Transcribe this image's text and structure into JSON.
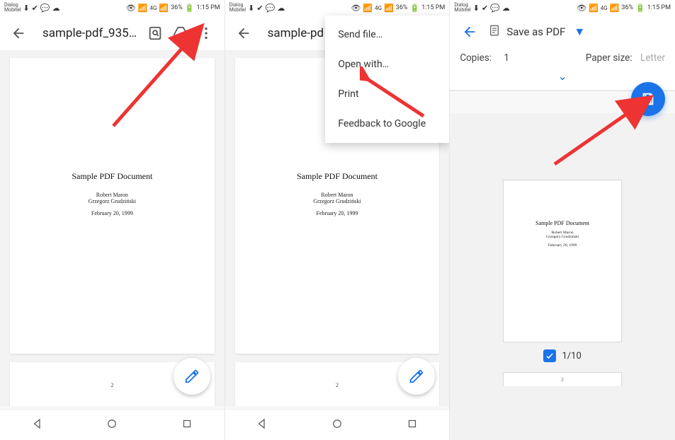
{
  "status": {
    "carrier": "Dialog\nMobitel",
    "battery": "36%",
    "time": "1:15 PM",
    "net": "4G"
  },
  "panel1": {
    "title": "sample-pdf_935…"
  },
  "doc": {
    "title": "Sample PDF Document",
    "author1": "Robert Maron",
    "author2": "Grzegorz Grudziński",
    "date": "February 20, 1999",
    "page2num": "2"
  },
  "panel2": {
    "title": "sample-pd",
    "menu": {
      "send": "Send file…",
      "open": "Open with…",
      "print": "Print",
      "feedback": "Feedback to Google"
    }
  },
  "panel3": {
    "saveas": "Save as PDF",
    "copies_label": "Copies:",
    "copies_value": "1",
    "paper_label": "Paper size:",
    "paper_value": "Letter",
    "pagecount": "1/10",
    "stubnum": "2"
  }
}
